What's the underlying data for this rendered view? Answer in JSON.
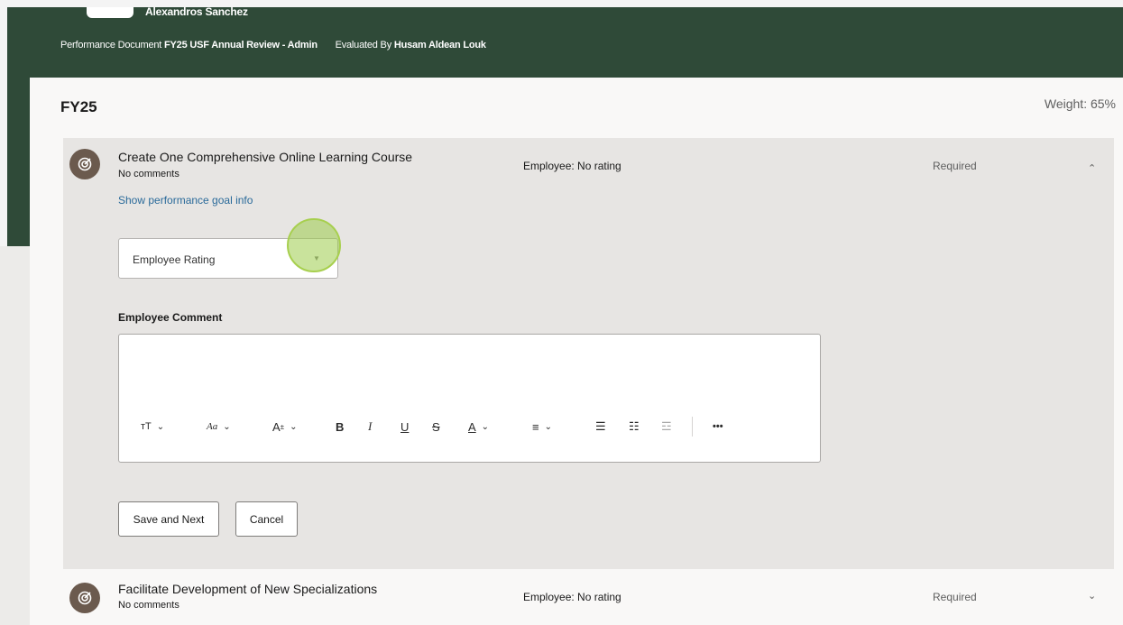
{
  "header": {
    "employee_name": "Alexandros Sanchez",
    "performance_document_label": "Performance Document",
    "performance_document_value": "FY25 USF Annual Review - Admin",
    "evaluated_by_label": "Evaluated By",
    "evaluated_by_value": "Husam Aldean Louk"
  },
  "section": {
    "title": "FY25",
    "weight": "Weight: 65%"
  },
  "goals": [
    {
      "icon": "target-icon",
      "title": "Create One Comprehensive Online Learning Course",
      "comments": "No comments",
      "rating": "Employee: No rating",
      "required": "Required",
      "chevron": "⌃",
      "info_link": "Show performance goal info"
    },
    {
      "icon": "target-icon",
      "title": "Facilitate Development of New Specializations",
      "comments": "No comments",
      "rating": "Employee: No rating",
      "required": "Required",
      "chevron": "⌄"
    }
  ],
  "form": {
    "rating_select_label": "Employee Rating",
    "rating_select_caret": "▼",
    "comment_label": "Employee Comment",
    "toolbar": {
      "text_style": "тT",
      "font": "Aa",
      "font_size": "A",
      "bold": "B",
      "italic": "I",
      "underline": "U",
      "strikethrough": "S",
      "font_color": "A",
      "align": "≡",
      "bullets": "☰",
      "numbers": "☷",
      "outdent": "☲",
      "more": "•••",
      "dropdown": "⌄"
    },
    "save_next_label": "Save and Next",
    "cancel_label": "Cancel"
  },
  "colors": {
    "header_bg": "#2f4a38",
    "panel_bg": "#f9f8f7",
    "expanded_bg": "#e7e5e3",
    "link": "#2a6a9a",
    "click_highlight": "#a7cf4e"
  }
}
